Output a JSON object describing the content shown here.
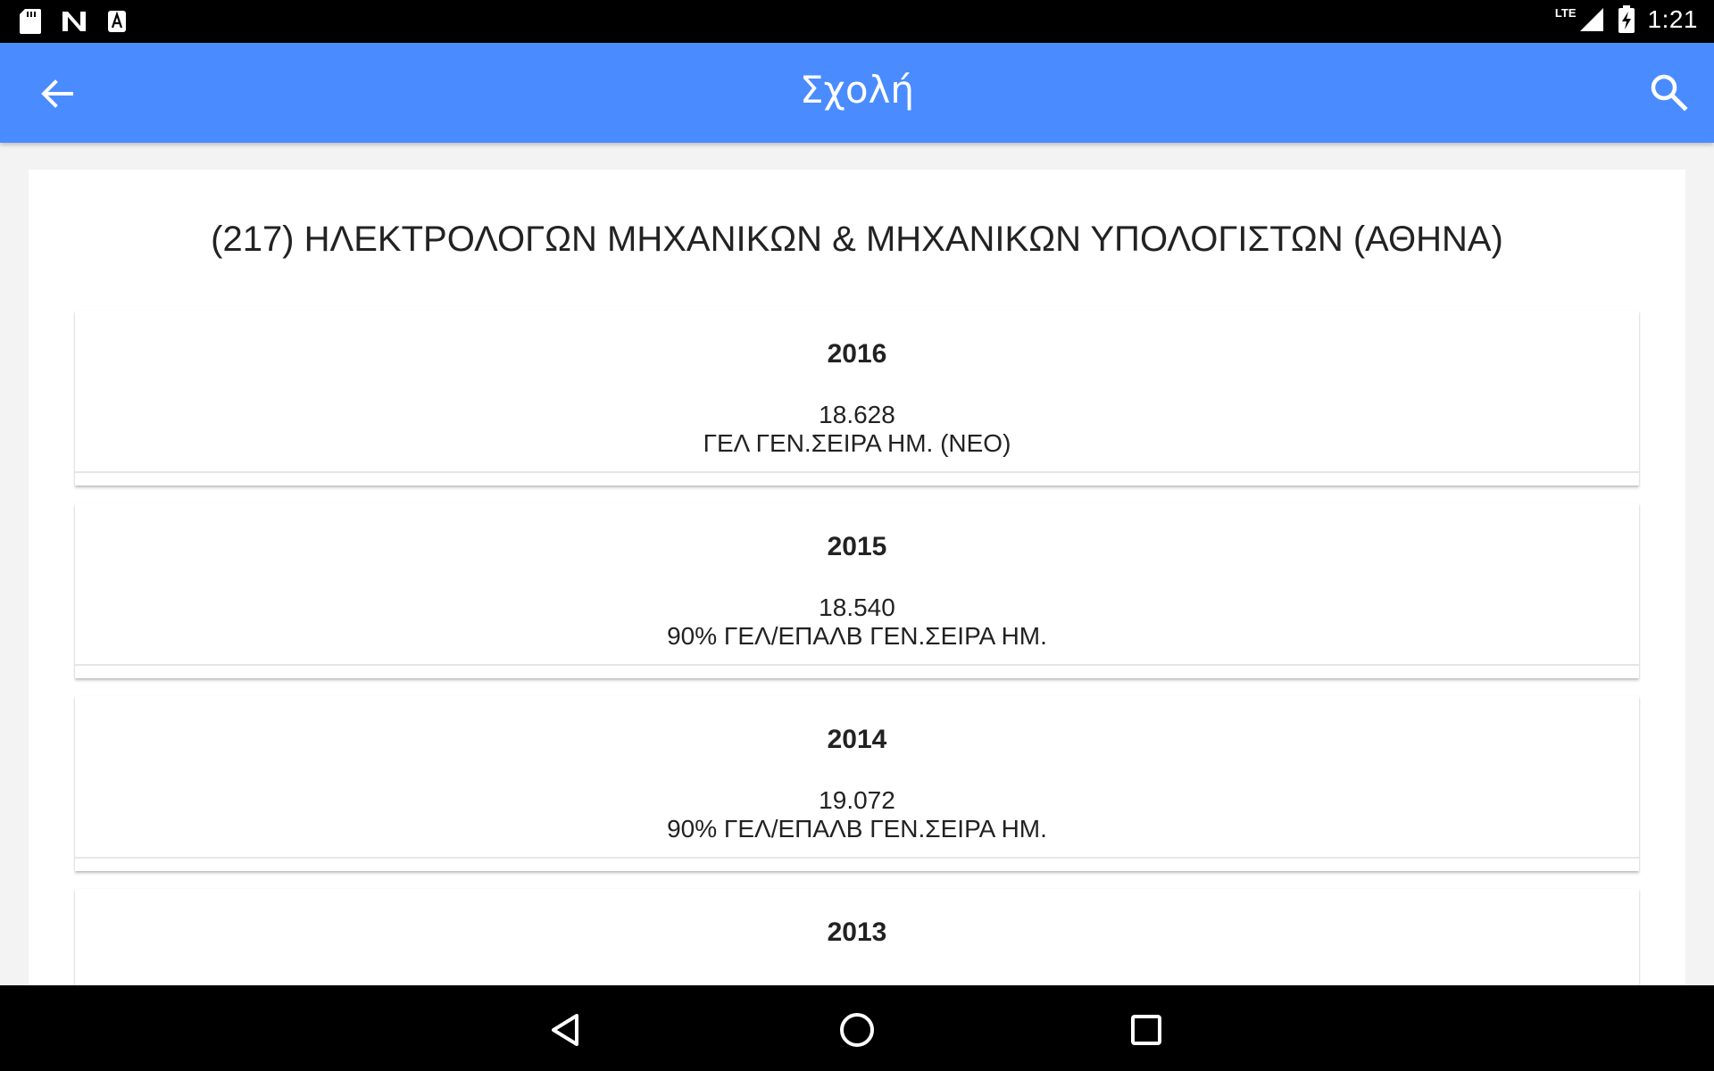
{
  "status_bar": {
    "network_label": "LTE",
    "time": "1:21"
  },
  "app_bar": {
    "title": "Σχολή"
  },
  "school": {
    "title": "(217) ΗΛΕΚΤΡΟΛΟΓΩΝ ΜΗΧΑΝΙΚΩΝ & ΜΗΧΑΝΙΚΩΝ ΥΠΟΛΟΓΙΣΤΩΝ (ΑΘΗΝΑ)"
  },
  "years": [
    {
      "year": "2016",
      "score": "18.628",
      "category": "ΓΕΛ ΓΕΝ.ΣΕΙΡΑ ΗΜ. (ΝΕΟ)"
    },
    {
      "year": "2015",
      "score": "18.540",
      "category": "90% ΓΕΛ/ΕΠΑΛΒ ΓΕΝ.ΣΕΙΡΑ ΗΜ."
    },
    {
      "year": "2014",
      "score": "19.072",
      "category": "90% ΓΕΛ/ΕΠΑΛΒ ΓΕΝ.ΣΕΙΡΑ ΗΜ."
    },
    {
      "year": "2013",
      "score": "",
      "category": ""
    }
  ],
  "colors": {
    "app_bar": "#4a8cff",
    "background": "#f3f3f3",
    "text": "#222222"
  },
  "icons": {
    "status_left": [
      "sd-card-icon",
      "n-app-icon",
      "a-app-icon"
    ],
    "status_right": [
      "cell-signal-icon",
      "battery-charging-icon"
    ],
    "app_bar": [
      "arrow-back-icon",
      "search-icon"
    ],
    "navigation": [
      "back-triangle-icon",
      "home-circle-icon",
      "recents-square-icon"
    ]
  }
}
